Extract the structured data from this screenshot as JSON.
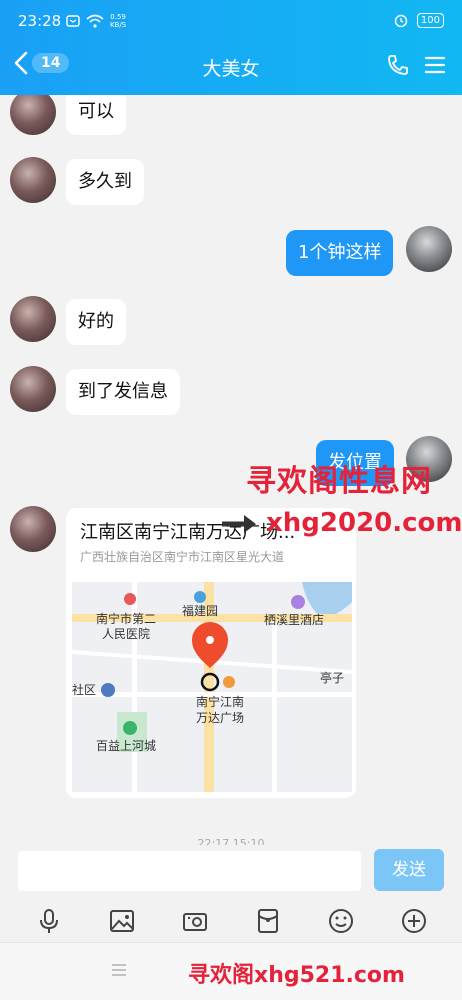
{
  "status": {
    "time": "23:28",
    "speed_value": "0.59",
    "speed_unit": "KB/S",
    "battery": "100"
  },
  "header": {
    "back_count": "14",
    "title": "大美女"
  },
  "messages": [
    {
      "text": "可以"
    },
    {
      "text": "多久到"
    },
    {
      "text": "1个钟这样"
    },
    {
      "text": "好的"
    },
    {
      "text": "到了发信息"
    },
    {
      "text": "发位置"
    }
  ],
  "location_card": {
    "title": "江南区南宁江南万达广场...",
    "address": "广西壮族自治区南宁市江南区星光大道",
    "map_labels": [
      "南宁市第二",
      "人民医院",
      "福建园",
      "栖溪里酒店",
      "社区",
      "南宁江南",
      "万达广场",
      "亭子",
      "百益上河城"
    ]
  },
  "timestamp_partial": "22:17 15:10",
  "watermarks": {
    "line1": "寻欢阁性息网",
    "line2": "xhg2020.com",
    "line3": "寻欢阁xhg521.com"
  },
  "input": {
    "placeholder": "",
    "send_label": "发送"
  },
  "colors": {
    "header": "#1aa0f5",
    "bubble_out": "#1f97f7",
    "send_disabled": "#7cc6f7",
    "watermark": "#e4233b"
  }
}
